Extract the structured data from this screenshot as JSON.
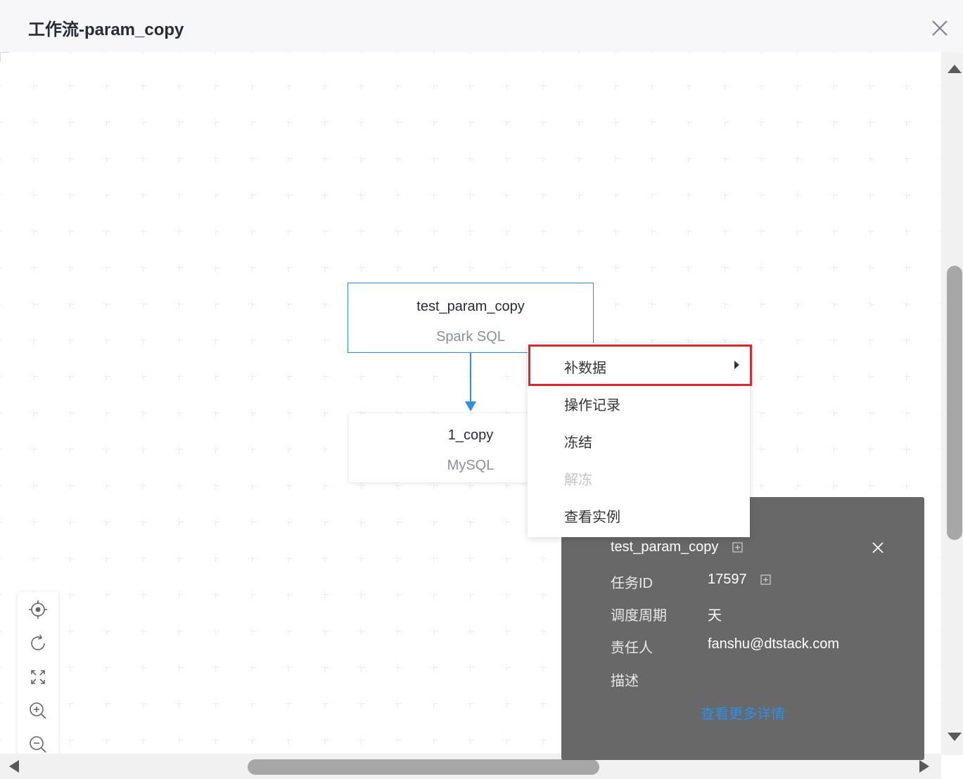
{
  "header": {
    "title": "工作流-param_copy"
  },
  "nodes": [
    {
      "name": "test_param_copy",
      "type": "Spark SQL"
    },
    {
      "name": "1_copy",
      "type": "MySQL"
    }
  ],
  "context_menu": {
    "items": [
      {
        "label": "补数据",
        "has_submenu": true,
        "disabled": false
      },
      {
        "label": "操作记录",
        "disabled": false
      },
      {
        "label": "冻结",
        "disabled": false
      },
      {
        "label": "解冻",
        "disabled": true
      },
      {
        "label": "查看实例",
        "disabled": false
      }
    ]
  },
  "info_panel": {
    "task_name": "test_param_copy",
    "rows": [
      {
        "label": "任务ID",
        "value": "17597"
      },
      {
        "label": "调度周期",
        "value": "天"
      },
      {
        "label": "责任人",
        "value": "fanshu@dtstack.com"
      },
      {
        "label": "描述",
        "value": ""
      }
    ],
    "more_link": "查看更多详情"
  },
  "toolbar": {
    "icons": [
      "locate-icon",
      "refresh-icon",
      "fit-screen-icon",
      "zoom-in-icon",
      "zoom-out-icon"
    ]
  },
  "colors": {
    "accent": "#2e8fe6",
    "highlight_border": "#e0272e",
    "panel_bg": "#626262"
  }
}
